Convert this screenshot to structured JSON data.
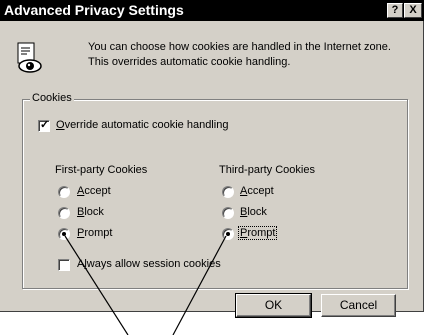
{
  "window": {
    "title": "Advanced Privacy Settings",
    "help_button": "?",
    "close_button": "X"
  },
  "info": {
    "text": "You can choose how cookies are handled in the Internet zone.  This overrides automatic cookie handling."
  },
  "cookies_group": {
    "label": "Cookies",
    "override": {
      "label": "Override automatic cookie handling",
      "checked": true
    },
    "first_party": {
      "label": "First-party Cookies",
      "options": [
        "Accept",
        "Block",
        "Prompt"
      ],
      "selected": "Prompt"
    },
    "third_party": {
      "label": "Third-party Cookies",
      "options": [
        "Accept",
        "Block",
        "Prompt"
      ],
      "selected": "Prompt"
    },
    "session": {
      "label": "Always allow session cookies",
      "checked": false
    }
  },
  "buttons": {
    "ok": "OK",
    "cancel": "Cancel"
  }
}
